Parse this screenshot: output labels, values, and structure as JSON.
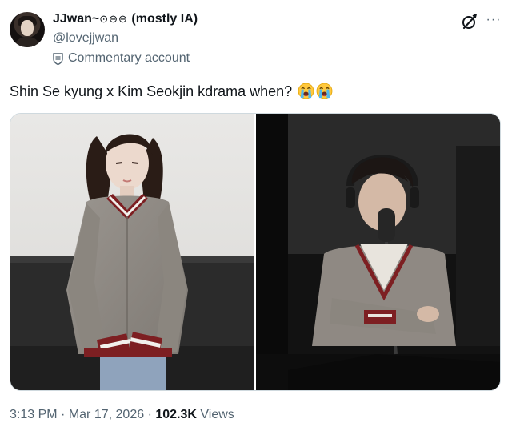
{
  "author": {
    "display_name": "JJwan~",
    "name_emojis": "⊙⊖⊖",
    "name_suffix": "(mostly IA)",
    "handle": "@lovejjwan",
    "badge_label": "Commentary account",
    "avatar_icon": "profile-photo"
  },
  "header_actions": {
    "grok_icon": "grok-icon",
    "more_icon": "more-options-icon",
    "more_glyph": "···"
  },
  "tweet": {
    "text": "Shin Se kyung x Kim Seokjin kdrama when?",
    "emojis": [
      "loudly-crying-face",
      "loudly-crying-face"
    ]
  },
  "media": {
    "photos": [
      {
        "name": "photo-woman-sweater",
        "icon": "photo"
      },
      {
        "name": "photo-man-microphone",
        "icon": "photo"
      }
    ]
  },
  "footer": {
    "time": "3:13 PM",
    "separator": "·",
    "date": "Mar 17, 2026",
    "views_count": "102.3K",
    "views_label": "Views"
  },
  "colors": {
    "text_primary": "#0f1419",
    "text_secondary": "#536471",
    "border": "#cfd9de",
    "sweater_red": "#7d1f22",
    "sweater_gray": "#8f8983"
  }
}
